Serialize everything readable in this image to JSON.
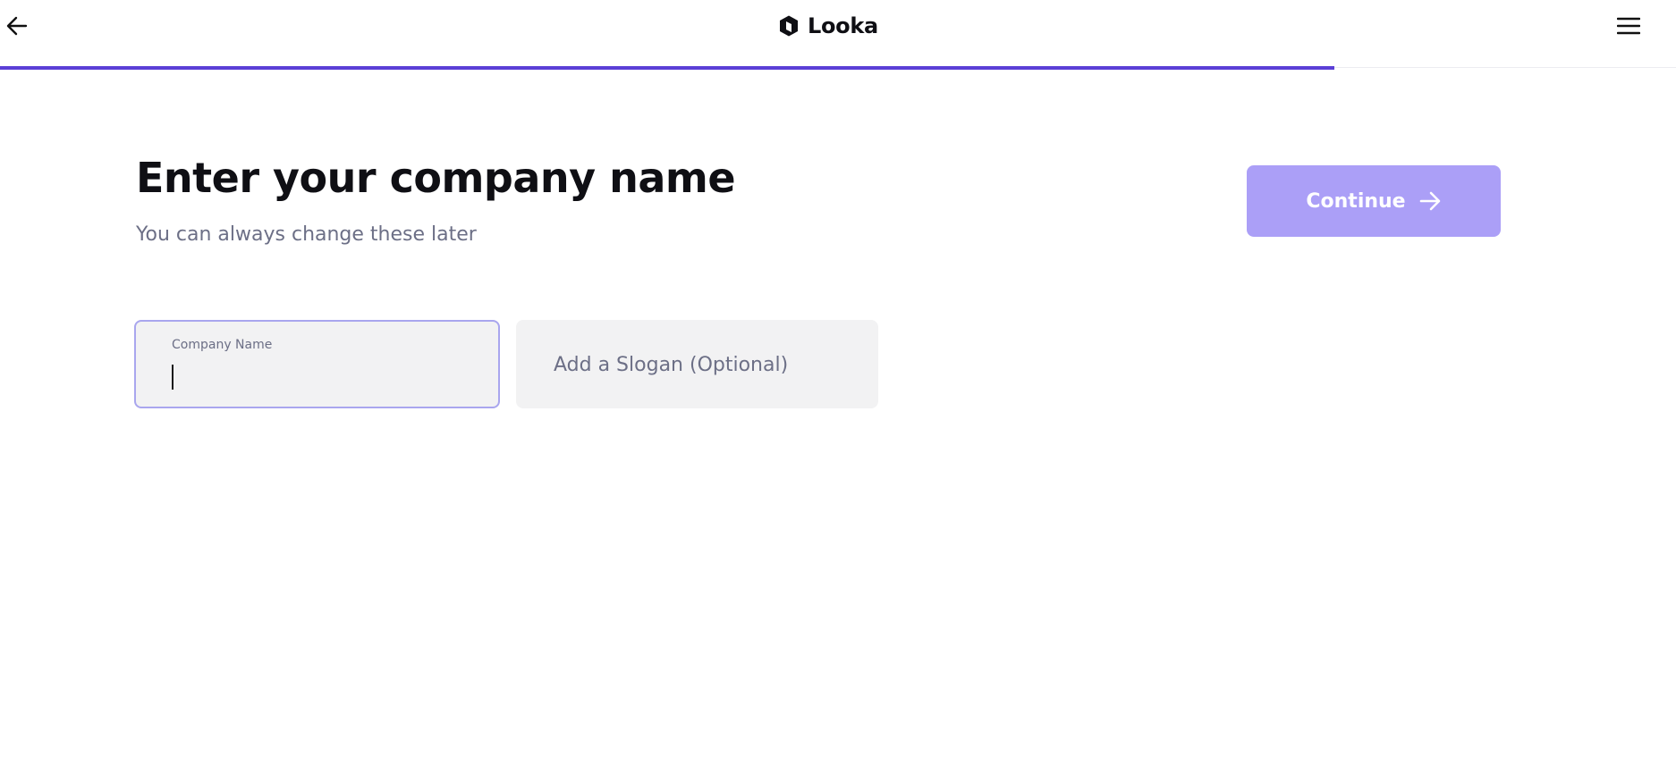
{
  "header": {
    "logo_text": "Looka",
    "back_icon": "arrow-left-icon",
    "menu_icon": "hamburger-menu-icon"
  },
  "progress": {
    "fraction": 0.796,
    "color": "#5b3fd6"
  },
  "main": {
    "title": "Enter your company name",
    "subtitle": "You can always change these later",
    "continue_label": "Continue",
    "continue_icon": "arrow-right-icon",
    "continue_color": "#ab9ff7"
  },
  "fields": {
    "company_name": {
      "label": "Company Name",
      "value": ""
    },
    "slogan": {
      "placeholder": "Add a Slogan (Optional)",
      "value": ""
    }
  },
  "colors": {
    "accent": "#5b3fd6",
    "focus_border": "#a9a6ee",
    "field_bg": "#f2f2f3",
    "muted_text": "#6c6f86"
  }
}
